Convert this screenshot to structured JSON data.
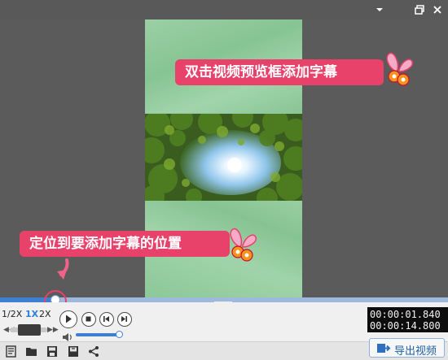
{
  "window": {
    "buttons": [
      {
        "icon": "chevron-down-icon"
      },
      {
        "icon": "restore-icon"
      },
      {
        "icon": "close-icon"
      }
    ]
  },
  "preview": {
    "callout_top": "双击视频预览框添加字幕",
    "callout_bottom": "定位到要添加字幕的位置",
    "accent_color": "#e8416a"
  },
  "timeline": {
    "progress": 0.124
  },
  "speed": {
    "options": [
      "1/2X",
      "1X",
      "2X"
    ],
    "selected": "1X"
  },
  "playback": {
    "buttons": [
      "play-icon",
      "stop-icon",
      "previous-frame-icon",
      "next-frame-icon"
    ]
  },
  "volume": {
    "level": 0.95
  },
  "time": {
    "current": "00:00:01.840",
    "total": "00:00:14.800"
  },
  "toolbar": {
    "icons": [
      "new-project-icon",
      "open-folder-icon",
      "save-icon",
      "save-as-icon",
      "share-icon"
    ],
    "export_label": "导出视频"
  }
}
